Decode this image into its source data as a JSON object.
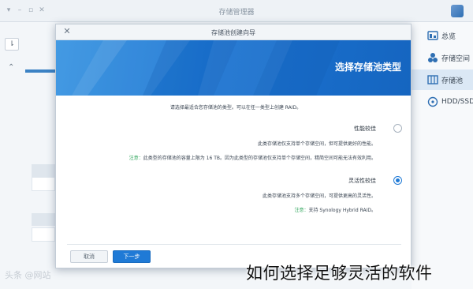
{
  "background_window": {
    "title": "存储管理器",
    "sidebar": [
      {
        "label": "总览",
        "icon": "overview-icon"
      },
      {
        "label": "存储空间",
        "icon": "volume-icon"
      },
      {
        "label": "存储池",
        "icon": "storage-pool-icon",
        "active": true
      },
      {
        "label": "HDD/SSD",
        "icon": "disk-icon"
      }
    ]
  },
  "dialog": {
    "title": "存储池创建向导",
    "heading": "选择存储池类型",
    "intro": "请选择最适合您存储池的类型。可以在任一类型上创建 RAID。",
    "options": [
      {
        "label": "性能较佳",
        "selected": false,
        "lines": [
          "此类存储池仅支持单个存储空间，但可提供更好的性能。"
        ],
        "note_label": "注意：",
        "note": "此类型的存储池的容量上限为 16 TB。因为此类型的存储池仅支持单个存储空间，精简空间可能无法有效利用。"
      },
      {
        "label": "灵活性较佳",
        "selected": true,
        "lines": [
          "此类存储池支持多个存储空间，可提供更高的灵活性。"
        ],
        "note_label": "注意：",
        "note": "支持 Synology Hybrid RAID。"
      }
    ],
    "buttons": {
      "cancel": "取消",
      "next": "下一步"
    }
  },
  "watermark": "头条 @网站",
  "caption": "如何选择足够灵活的软件",
  "colors": {
    "accent": "#1f7ad6",
    "banner": "#1b73d1",
    "note": "#2fa55b"
  }
}
